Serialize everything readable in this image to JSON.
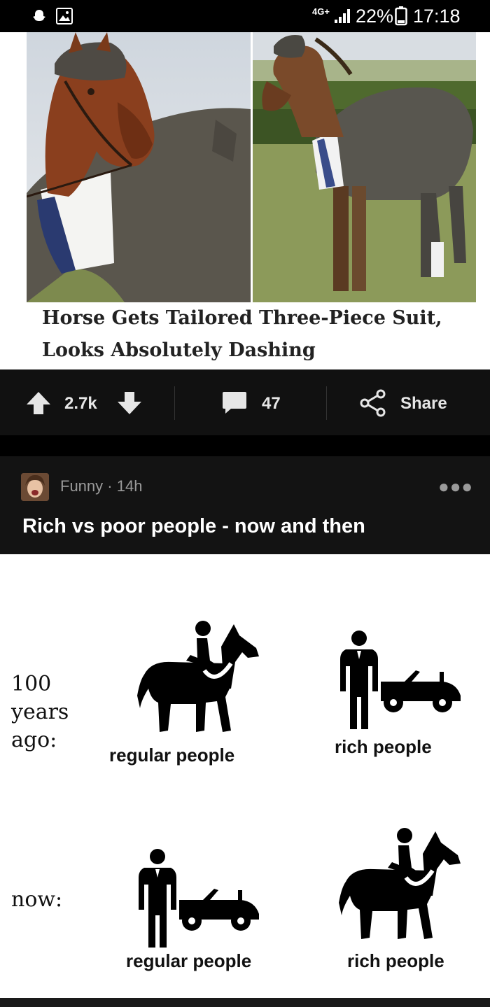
{
  "status_bar": {
    "network": "4G+",
    "battery": "22%",
    "time": "17:18"
  },
  "post1": {
    "headline_line1": "Horse Gets Tailored Three-Piece Suit,",
    "headline_line2": "Looks Absolutely Dashing",
    "upvotes": "2.7k",
    "comments": "47",
    "share_label": "Share"
  },
  "post2": {
    "section": "Funny",
    "age": "14h",
    "title": "Rich vs poor people - now and then",
    "meme": {
      "row1_label_lines": [
        "100",
        "years",
        "ago:"
      ],
      "row1_left_caption": "regular people",
      "row1_right_caption": "rich people",
      "row2_label": "now:",
      "row2_left_caption": "regular people",
      "row2_right_caption": "rich people"
    }
  },
  "colors": {
    "background": "#000000",
    "action_bar": "#111111",
    "post_header": "#131313",
    "meta_text": "#9a9a9a"
  }
}
